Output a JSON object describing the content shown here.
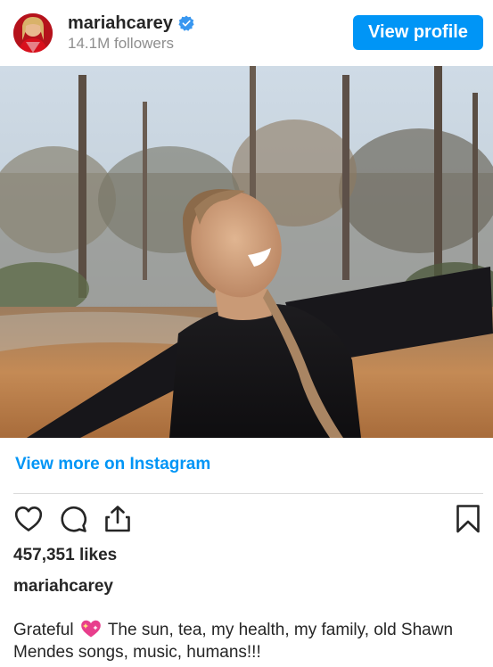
{
  "header": {
    "username": "mariahcarey",
    "followers": "14.1M followers",
    "view_profile_label": "View profile"
  },
  "post": {
    "view_more_label": "View more on Instagram",
    "likes": "457,351 likes",
    "caption_user": "mariahcarey",
    "caption_before": "Grateful",
    "caption_after": "The sun, tea, my health, my family, old Shawn Mendes songs, music, humans!!!"
  },
  "icons": [
    "verified-badge-icon",
    "heart-icon",
    "comment-icon",
    "share-icon",
    "bookmark-icon",
    "sparkling-heart-emoji"
  ],
  "colors": {
    "accent": "#0095f6",
    "text": "#262626",
    "secondary_text": "#8e8e8e",
    "divider": "#dbdbdb"
  }
}
